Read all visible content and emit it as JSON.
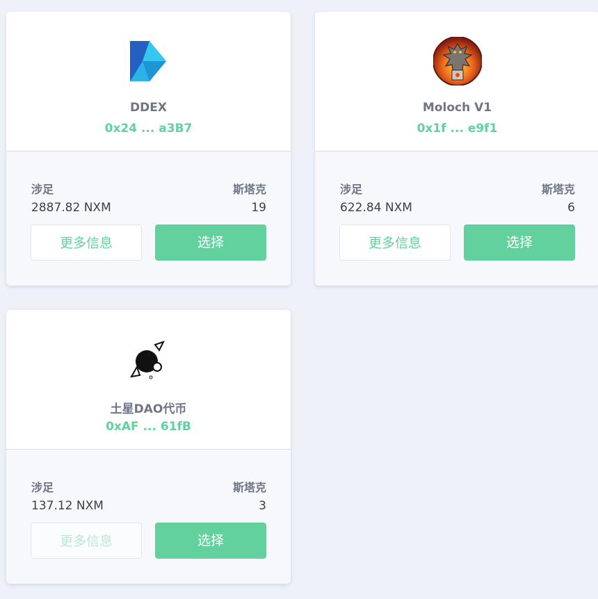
{
  "cards": [
    {
      "name": "DDEX",
      "address": "0x24 ... a3B7",
      "staked_label": "涉足",
      "staked_value": "2887.82 NXM",
      "stakers_label": "斯塔克",
      "stakers_value": "19",
      "more_info_label": "更多信息",
      "select_label": "选择",
      "icon": "ddex-logo-icon"
    },
    {
      "name": "Moloch V1",
      "address": "0x1f ... e9f1",
      "staked_label": "涉足",
      "staked_value": "622.84 NXM",
      "stakers_label": "斯塔克",
      "stakers_value": "6",
      "more_info_label": "更多信息",
      "select_label": "选择",
      "icon": "moloch-logo-icon"
    },
    {
      "name": "土星DAO代币",
      "address": "0xAF ... 61fB",
      "staked_label": "涉足",
      "staked_value": "137.12 NXM",
      "stakers_label": "斯塔克",
      "stakers_value": "3",
      "more_info_label": "更多信息",
      "select_label": "选择",
      "icon": "saturn-dao-logo-icon",
      "more_info_disabled": true
    }
  ],
  "colors": {
    "accent": "#62d19e",
    "background": "#eef1f8",
    "card_bottom": "#f7f8fc",
    "label": "#6f7585"
  }
}
